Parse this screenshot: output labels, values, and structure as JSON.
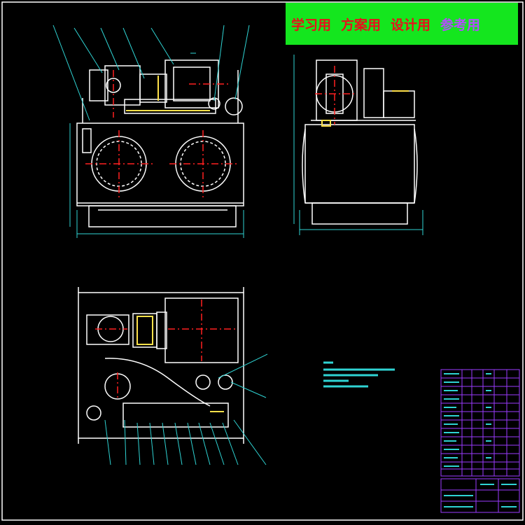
{
  "banner": {
    "labels": [
      "学习用",
      "方案用",
      "设计用",
      "参考用"
    ],
    "colors": {
      "red": "#e8101a",
      "purple": "#b44cff",
      "background": "#14e61e"
    }
  },
  "drawing": {
    "background": "#000000",
    "line_colors": {
      "outline": "#ffffff",
      "centerline": "#ff2020",
      "leader": "#2fd3d3",
      "dimension": "#2fd3d3",
      "accent": "#ffe14a",
      "title_block": "#9b3bff"
    }
  }
}
